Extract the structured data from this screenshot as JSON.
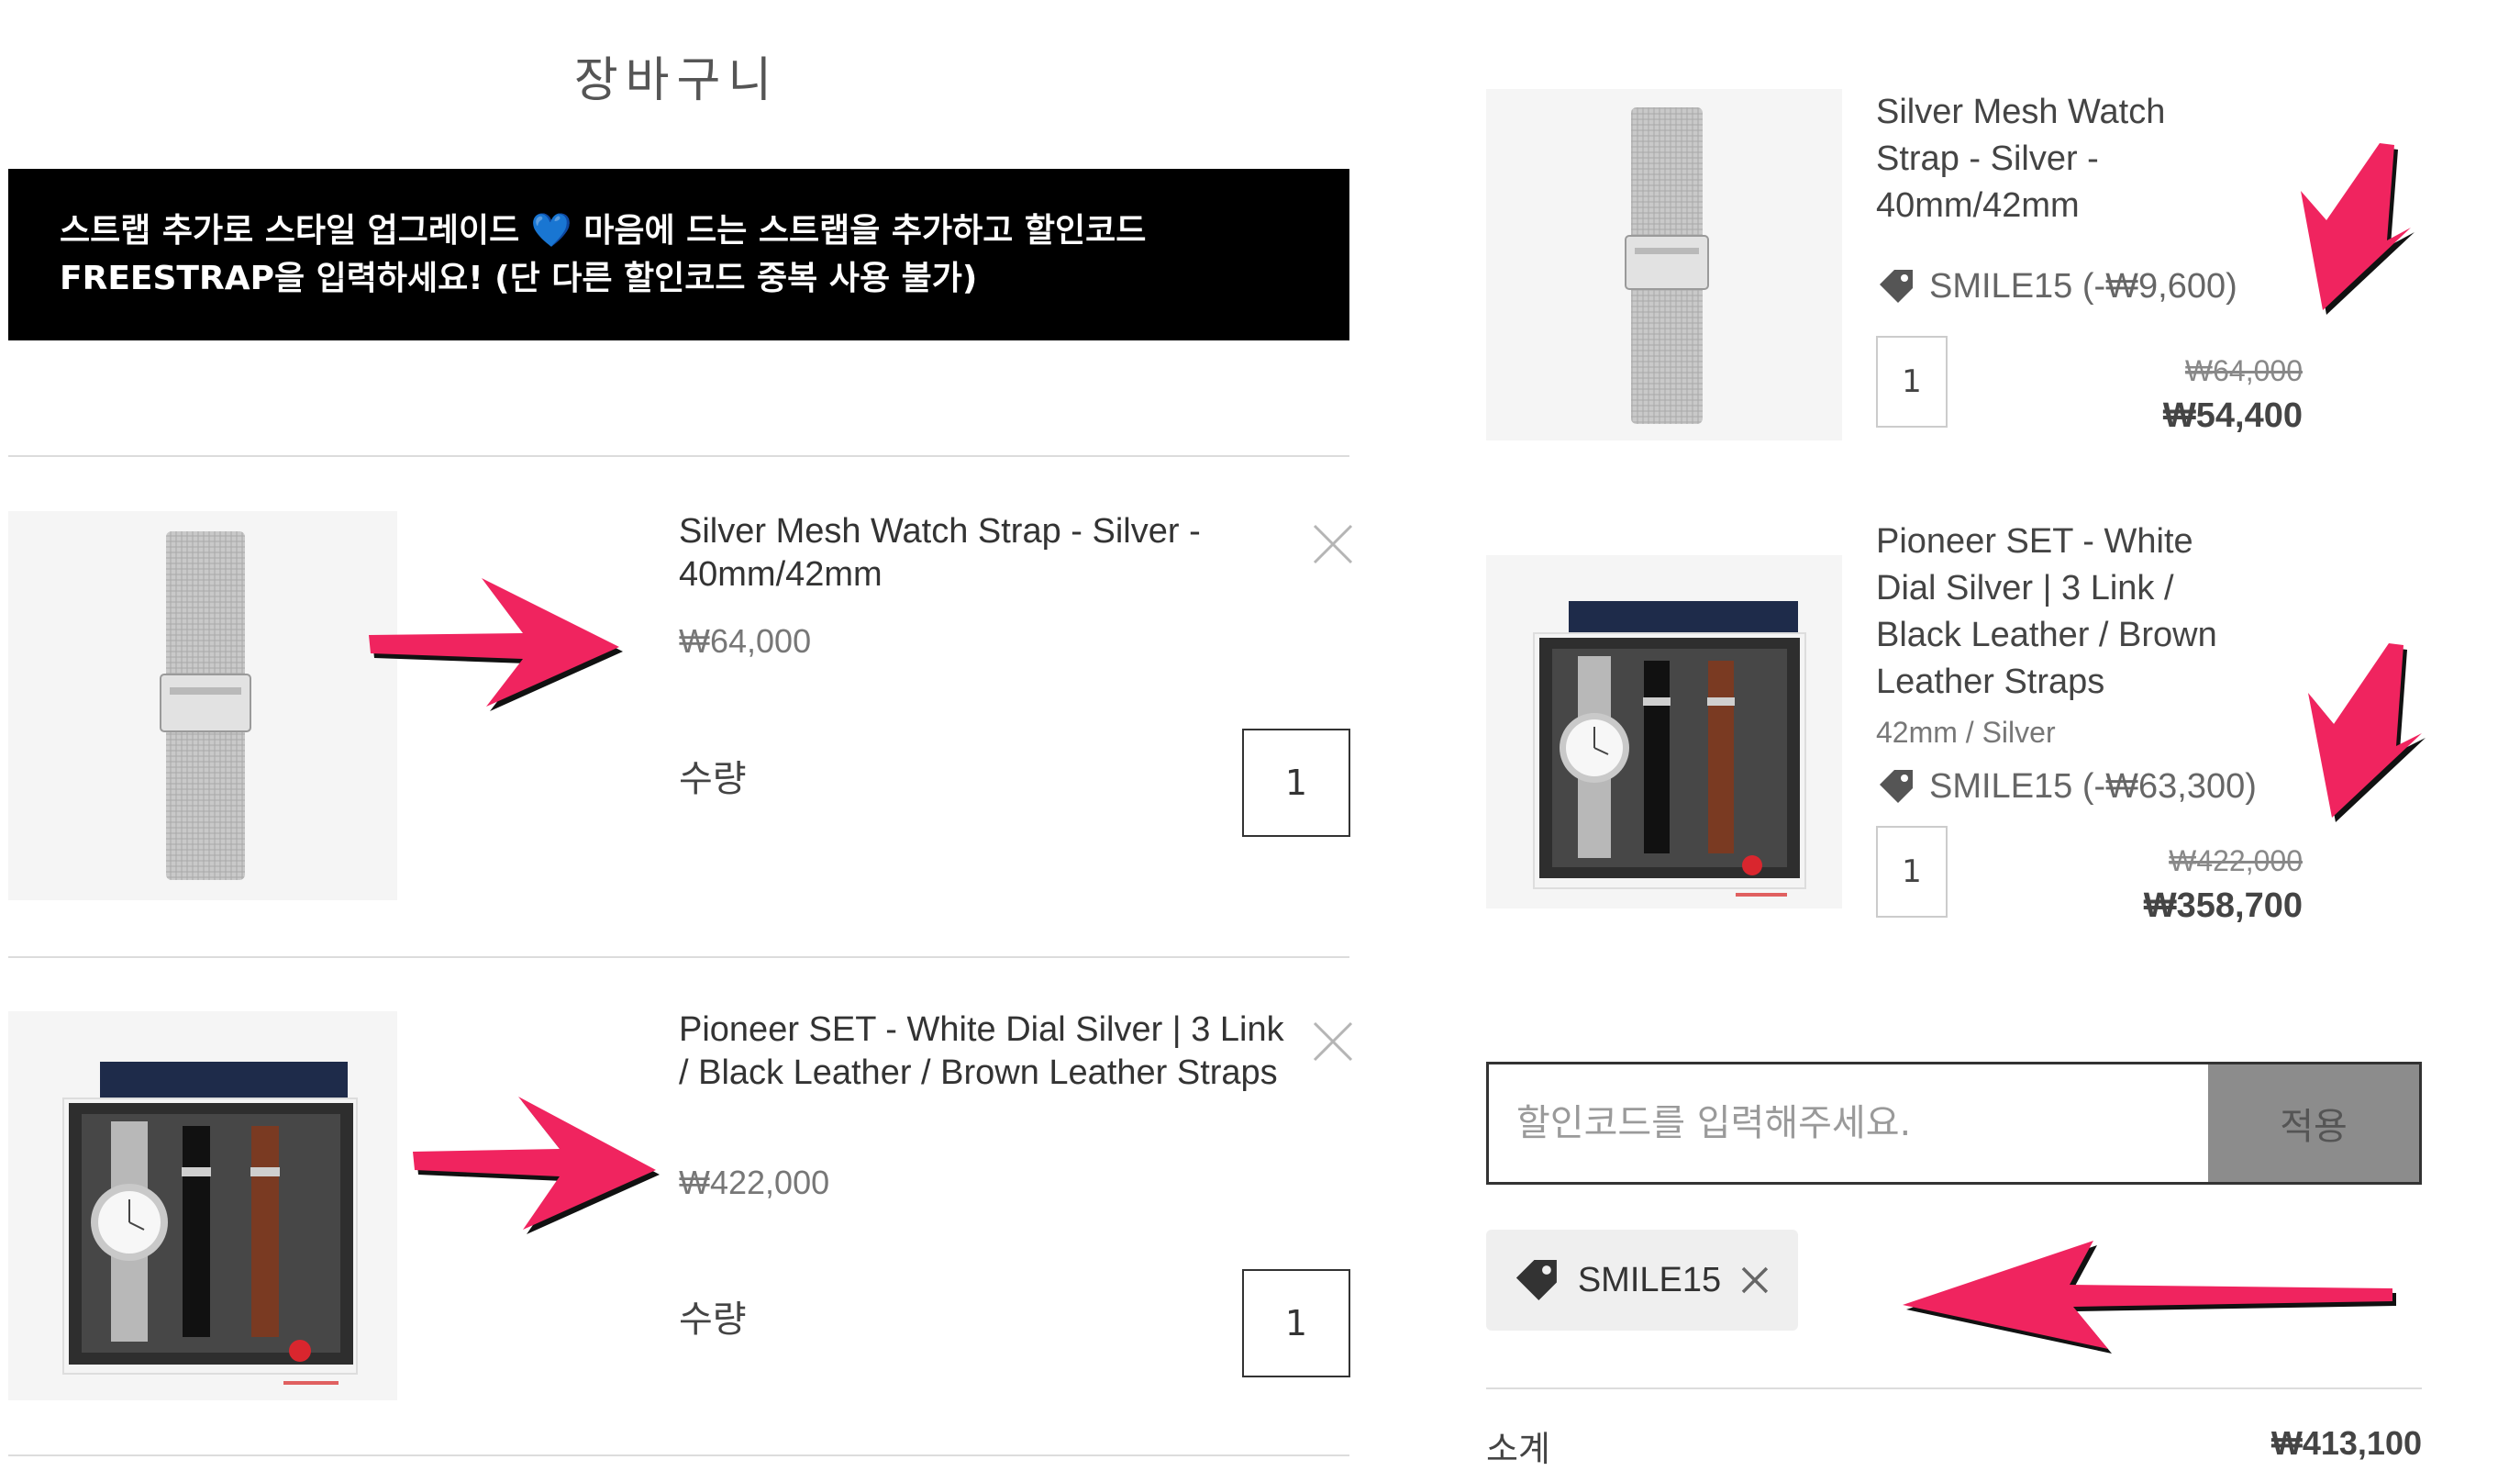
{
  "cart": {
    "title": "장바구니",
    "promo_line1": "스트랩 추가로 스타일 업그레이드",
    "promo_heart": "💙",
    "promo_line1_rest": "마음에 드는 스트랩을 추가하고 할인코드",
    "promo_line2": "FREESTRAP을 입력하세요! (단 다른 할인코드 중복 사용 불가)",
    "items": [
      {
        "name": "Silver Mesh Watch Strap - Silver - 40mm/42mm",
        "price": "₩64,000",
        "qty_label": "수량",
        "qty": "1"
      },
      {
        "name": "Pioneer SET - White Dial Silver | 3 Link / Black Leather / Brown Leather Straps",
        "price": "₩422,000",
        "qty_label": "수량",
        "qty": "1"
      }
    ]
  },
  "summary": {
    "items": [
      {
        "name_lines": [
          "Silver Mesh Watch",
          "Strap - Silver -",
          "40mm/42mm"
        ],
        "coupon": "SMILE15 (-₩9,600)",
        "qty": "1",
        "old_price": "₩64,000",
        "new_price": "₩54,400"
      },
      {
        "name_lines": [
          "Pioneer SET - White",
          "Dial Silver | 3 Link /",
          "Black Leather / Brown",
          "Leather Straps"
        ],
        "variant": "42mm / Silver",
        "coupon": "SMILE15 (-₩63,300)",
        "qty": "1",
        "old_price": "₩422,000",
        "new_price": "₩358,700"
      }
    ],
    "code_placeholder": "할인코드를 입력해주세요.",
    "apply_label": "적용",
    "applied_code": "SMILE15",
    "subtotal_label": "소계",
    "subtotal_value": "₩413,100"
  },
  "colors": {
    "arrow": "#f0245f",
    "banner_bg": "#000000",
    "apply_bg": "#8c8c8c"
  }
}
